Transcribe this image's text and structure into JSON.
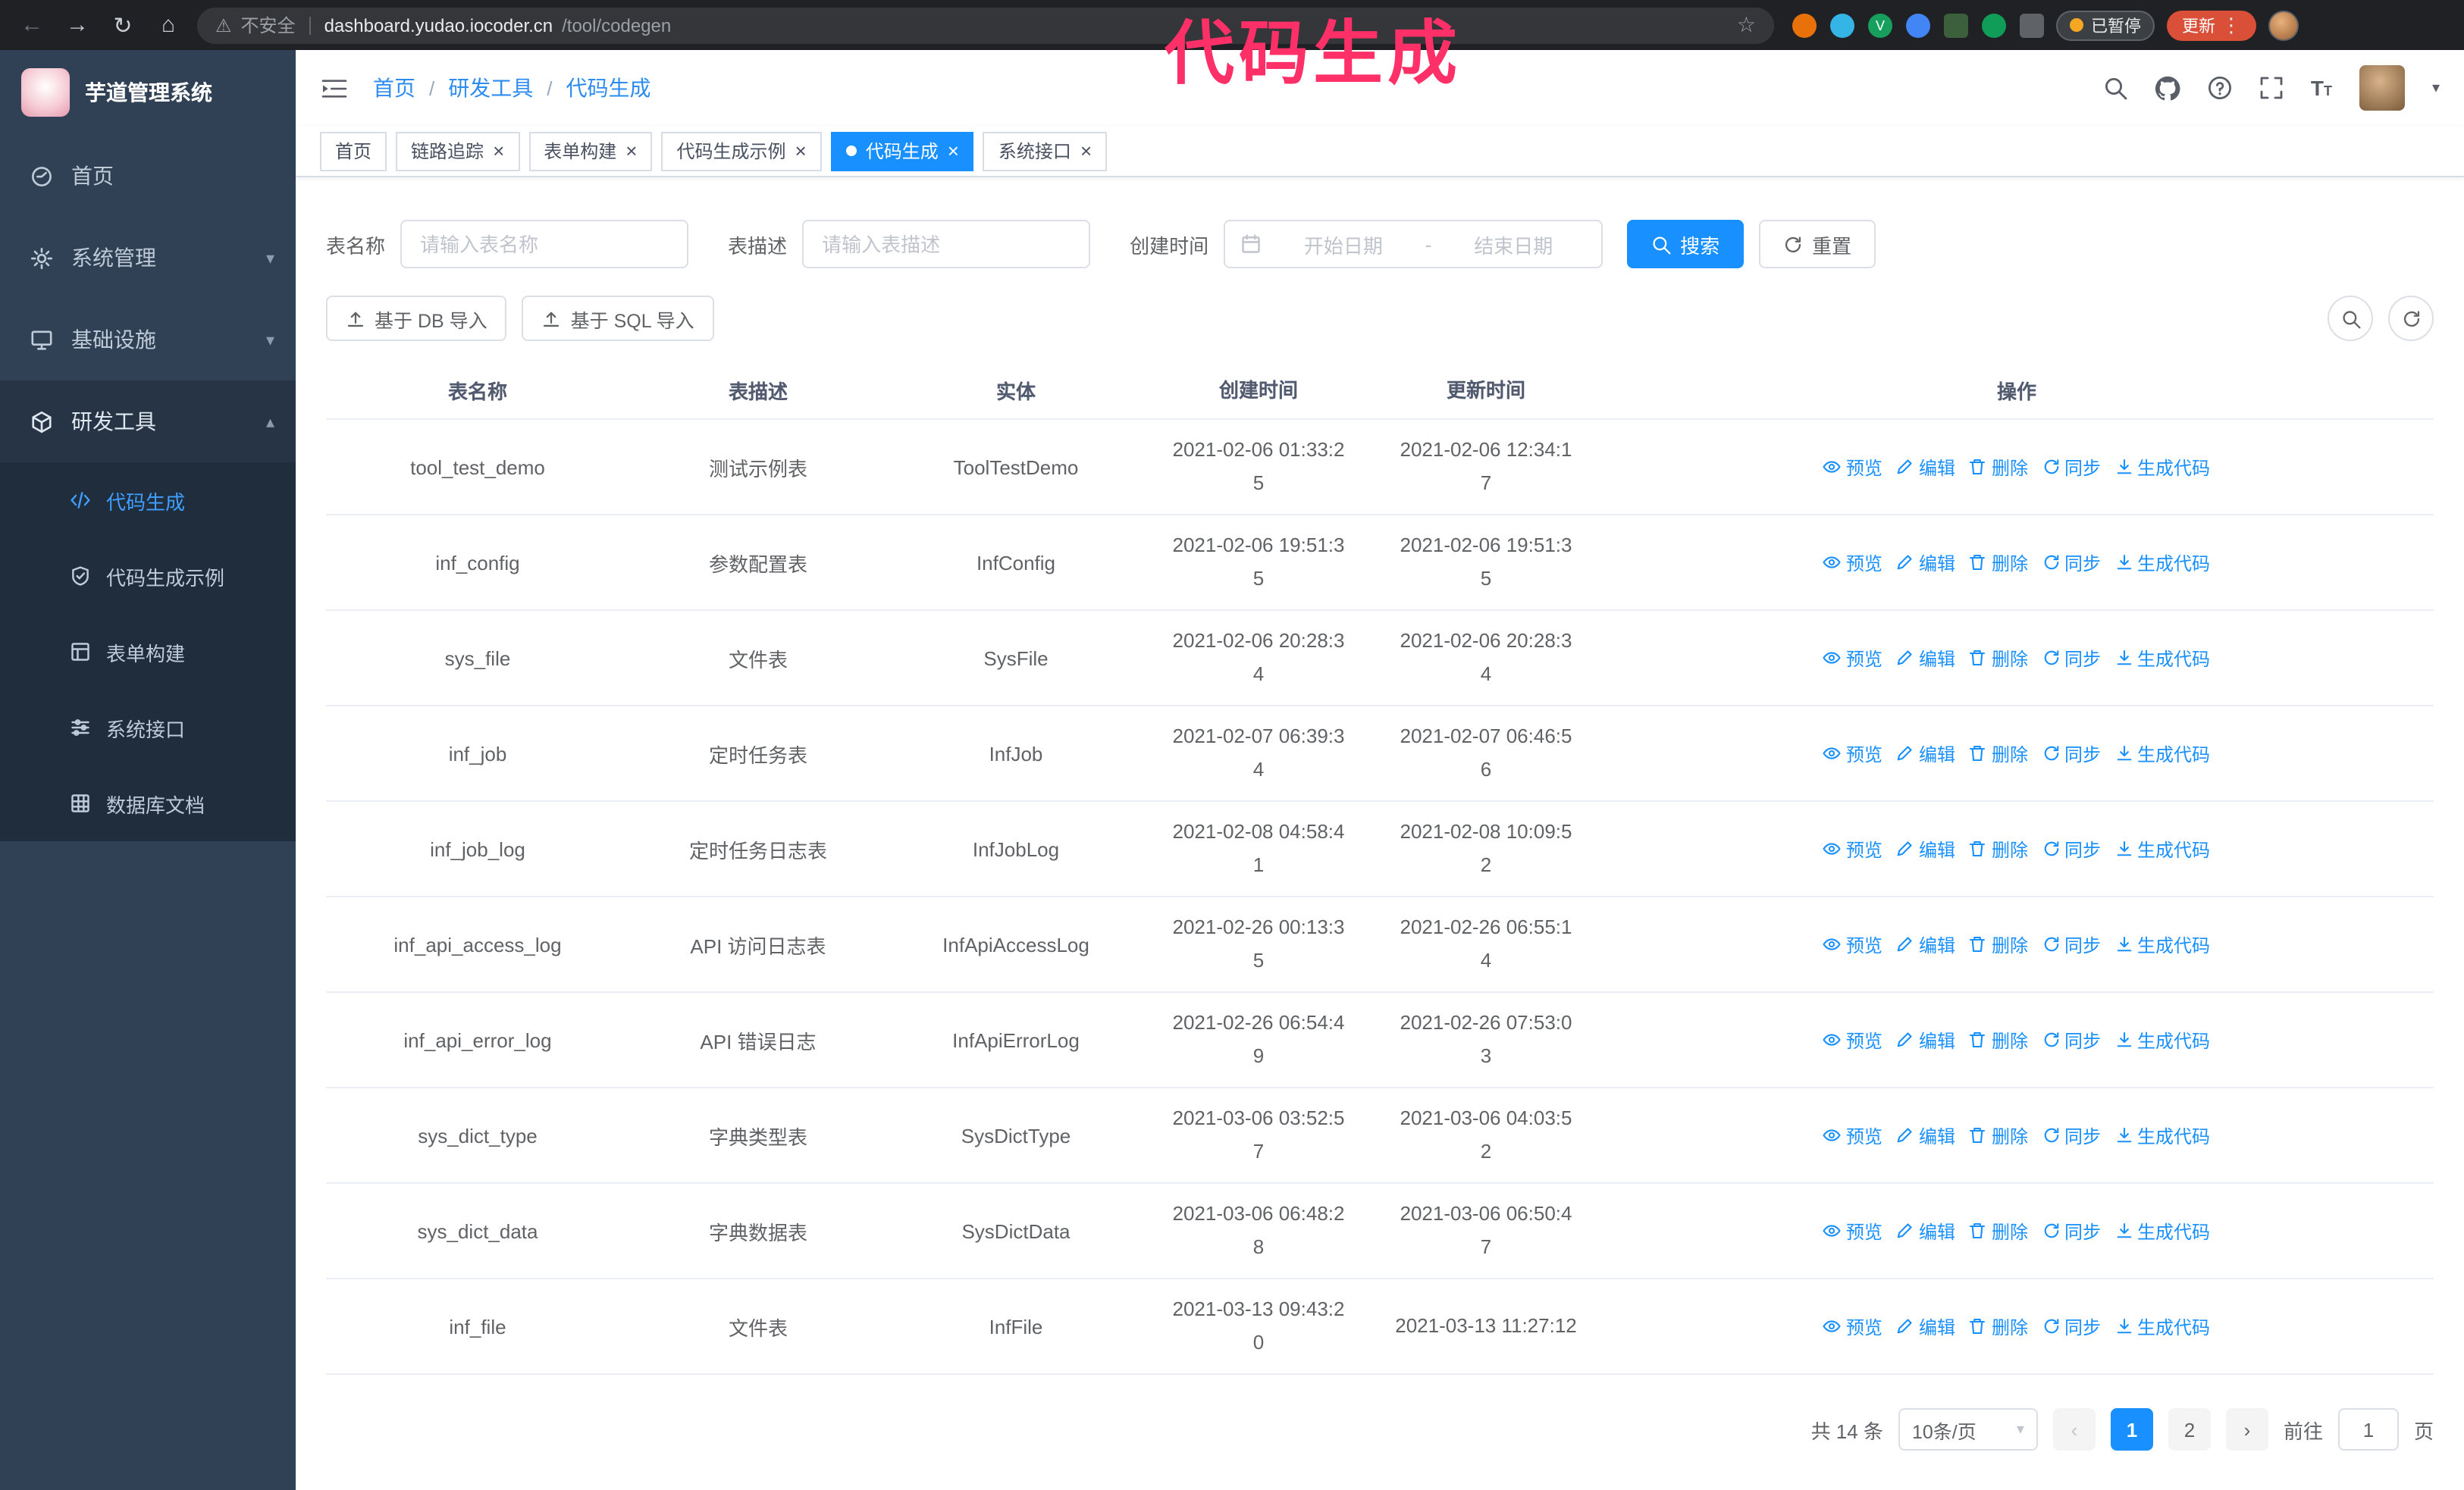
{
  "colors": {
    "primary": "#1890ff",
    "annotation": "#ff2f68",
    "sidebar": "#304156",
    "active_menu": "#409EFF"
  },
  "browser": {
    "not_secure_label": "不安全",
    "url_host": "dashboard.yudao.iocoder.cn",
    "url_path": "/tool/codegen",
    "paused_label": "已暂停",
    "update_label": "更新"
  },
  "annotation": {
    "text": "代码生成"
  },
  "sidebar": {
    "logo_title": "芋道管理系统",
    "items": [
      {
        "label": "首页"
      },
      {
        "label": "系统管理"
      },
      {
        "label": "基础设施"
      },
      {
        "label": "研发工具",
        "children": [
          {
            "label": "代码生成"
          },
          {
            "label": "代码生成示例"
          },
          {
            "label": "表单构建"
          },
          {
            "label": "系统接口"
          },
          {
            "label": "数据库文档"
          }
        ]
      }
    ]
  },
  "header": {
    "breadcrumb": [
      "首页",
      "研发工具",
      "代码生成"
    ]
  },
  "tabs": [
    {
      "label": "首页",
      "closable": false,
      "active": false
    },
    {
      "label": "链路追踪",
      "closable": true,
      "active": false
    },
    {
      "label": "表单构建",
      "closable": true,
      "active": false
    },
    {
      "label": "代码生成示例",
      "closable": true,
      "active": false
    },
    {
      "label": "代码生成",
      "closable": true,
      "active": true
    },
    {
      "label": "系统接口",
      "closable": true,
      "active": false
    }
  ],
  "filters": {
    "table_name_label": "表名称",
    "table_name_placeholder": "请输入表名称",
    "table_desc_label": "表描述",
    "table_desc_placeholder": "请输入表描述",
    "create_time_label": "创建时间",
    "start_placeholder": "开始日期",
    "range_separator": "-",
    "end_placeholder": "结束日期",
    "search_label": "搜索",
    "reset_label": "重置"
  },
  "toolbar": {
    "import_db_label": "基于 DB 导入",
    "import_sql_label": "基于 SQL 导入"
  },
  "table": {
    "columns": [
      "表名称",
      "表描述",
      "实体",
      "创建时间",
      "更新时间",
      "操作"
    ],
    "actions": [
      "预览",
      "编辑",
      "删除",
      "同步",
      "生成代码"
    ],
    "rows": [
      {
        "name": "tool_test_demo",
        "desc": "测试示例表",
        "entity": "ToolTestDemo",
        "created": "2021-02-06 01:33:25",
        "updated": "2021-02-06 12:34:17"
      },
      {
        "name": "inf_config",
        "desc": "参数配置表",
        "entity": "InfConfig",
        "created": "2021-02-06 19:51:35",
        "updated": "2021-02-06 19:51:35"
      },
      {
        "name": "sys_file",
        "desc": "文件表",
        "entity": "SysFile",
        "created": "2021-02-06 20:28:34",
        "updated": "2021-02-06 20:28:34"
      },
      {
        "name": "inf_job",
        "desc": "定时任务表",
        "entity": "InfJob",
        "created": "2021-02-07 06:39:34",
        "updated": "2021-02-07 06:46:56"
      },
      {
        "name": "inf_job_log",
        "desc": "定时任务日志表",
        "entity": "InfJobLog",
        "created": "2021-02-08 04:58:41",
        "updated": "2021-02-08 10:09:52"
      },
      {
        "name": "inf_api_access_log",
        "desc": "API 访问日志表",
        "entity": "InfApiAccessLog",
        "created": "2021-02-26 00:13:35",
        "updated": "2021-02-26 06:55:14"
      },
      {
        "name": "inf_api_error_log",
        "desc": "API 错误日志",
        "entity": "InfApiErrorLog",
        "created": "2021-02-26 06:54:49",
        "updated": "2021-02-26 07:53:03"
      },
      {
        "name": "sys_dict_type",
        "desc": "字典类型表",
        "entity": "SysDictType",
        "created": "2021-03-06 03:52:57",
        "updated": "2021-03-06 04:03:52"
      },
      {
        "name": "sys_dict_data",
        "desc": "字典数据表",
        "entity": "SysDictData",
        "created": "2021-03-06 06:48:28",
        "updated": "2021-03-06 06:50:47"
      },
      {
        "name": "inf_file",
        "desc": "文件表",
        "entity": "InfFile",
        "created": "2021-03-13 09:43:20",
        "updated": "2021-03-13 11:27:12"
      }
    ]
  },
  "pagination": {
    "total": "共 14 条",
    "page_size": "10条/页",
    "pages": [
      "1",
      "2"
    ],
    "active_page": "1",
    "goto_label": "前往",
    "goto_value": "1",
    "page_unit": "页"
  }
}
